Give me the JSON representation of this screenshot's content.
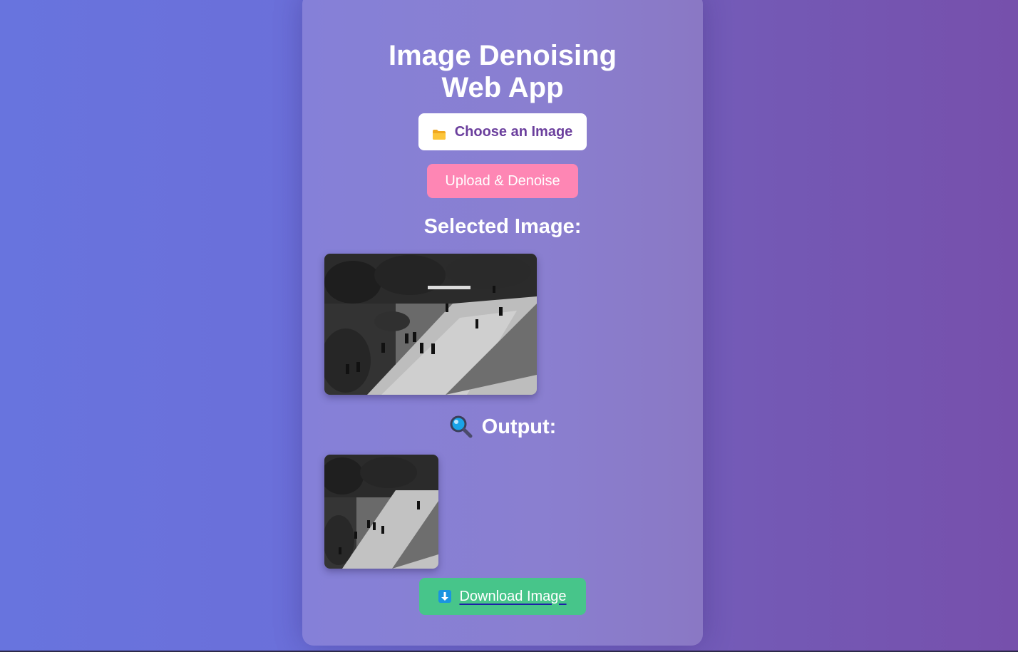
{
  "app": {
    "title": "Image Denoising Web App"
  },
  "controls": {
    "choose_label": "Choose an Image",
    "choose_icon": "folder-icon",
    "upload_label": "Upload & Denoise"
  },
  "sections": {
    "selected_heading": "Selected Image:",
    "output_heading": "Output:",
    "output_icon": "magnifier-icon"
  },
  "download": {
    "label": "Download Image",
    "icon": "download-arrow-icon"
  },
  "colors": {
    "choose_text": "#6b3f9d",
    "upload_bg": "#fe86b4",
    "download_bg": "#47c58a"
  }
}
